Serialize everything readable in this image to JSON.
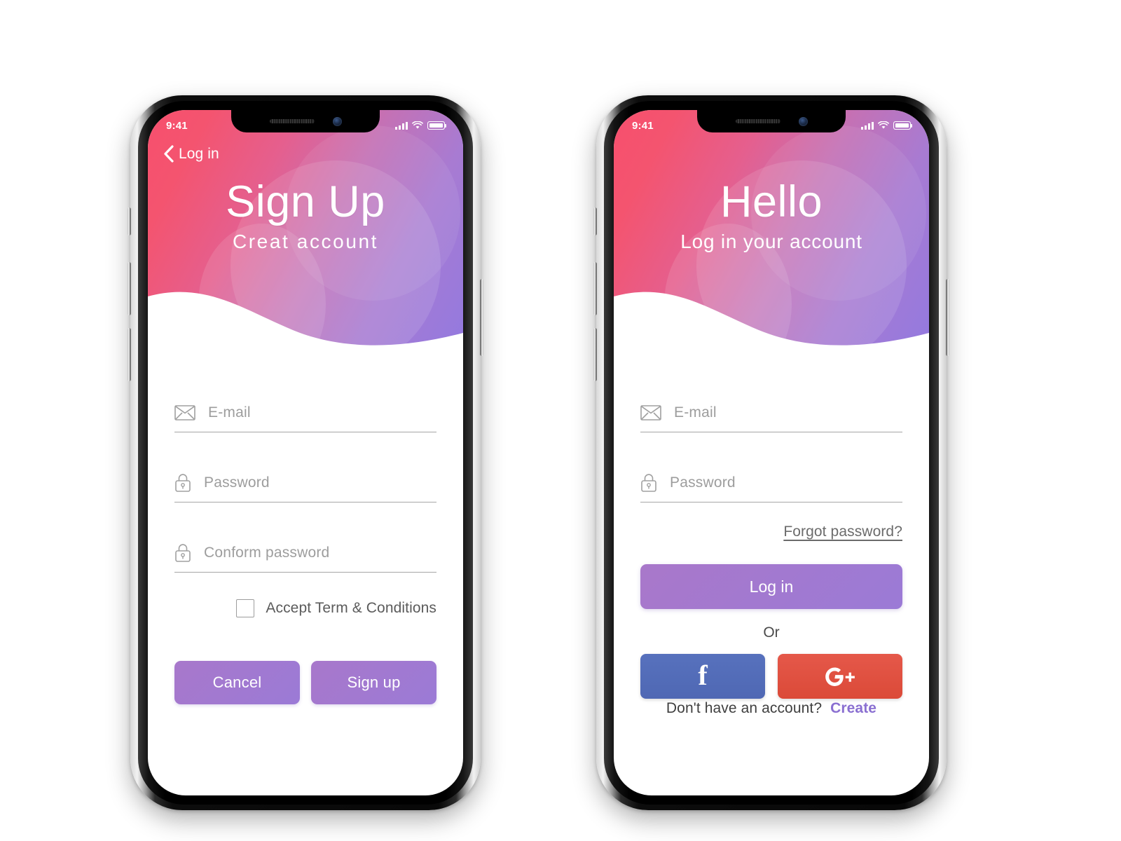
{
  "phones": [
    {
      "id": "signup",
      "statusbar": {
        "time": "9:41",
        "signal_icon": "signal-bars-icon",
        "wifi_icon": "wifi-icon",
        "battery_icon": "battery-full-icon"
      },
      "nav": {
        "visible": true,
        "back_icon": "chevron-left-icon",
        "back_label": "Log in"
      },
      "header": {
        "title": "Sign Up",
        "subtitle": "Creat  account",
        "gradient_start": "#f74f6e",
        "gradient_end": "#9279e0"
      },
      "fields": [
        {
          "icon": "envelope-icon",
          "placeholder": "E-mail",
          "value": ""
        },
        {
          "icon": "lock-icon",
          "placeholder": "Password",
          "value": ""
        },
        {
          "icon": "lock-icon",
          "placeholder": "Conform password",
          "value": ""
        }
      ],
      "terms": {
        "checked": false,
        "label": "Accept Term & Conditions"
      },
      "buttons": [
        {
          "label": "Cancel",
          "color": "#a878cb"
        },
        {
          "label": "Sign up",
          "color": "#9b7ad6"
        }
      ]
    },
    {
      "id": "login",
      "statusbar": {
        "time": "9:41",
        "signal_icon": "signal-bars-icon",
        "wifi_icon": "wifi-icon",
        "battery_icon": "battery-full-icon"
      },
      "nav": {
        "visible": false,
        "back_icon": "",
        "back_label": ""
      },
      "header": {
        "title": "Hello",
        "subtitle": "Log in your account",
        "gradient_start": "#f74f6e",
        "gradient_end": "#9279e0"
      },
      "fields": [
        {
          "icon": "envelope-icon",
          "placeholder": "E-mail",
          "value": ""
        },
        {
          "icon": "lock-icon",
          "placeholder": "Password",
          "value": ""
        }
      ],
      "forgot_link": "Forgot password?",
      "login_button": {
        "label": "Log in",
        "color": "#9b7ad6"
      },
      "or_label": "Or",
      "social_buttons": [
        {
          "name": "facebook",
          "glyph": "f",
          "color": "#4f68b4"
        },
        {
          "name": "google-plus",
          "glyph": "G+",
          "color": "#db4a38"
        }
      ],
      "footer": {
        "text": "Don't  have an account?",
        "link": "Create",
        "link_color": "#8a6fd1"
      }
    }
  ]
}
